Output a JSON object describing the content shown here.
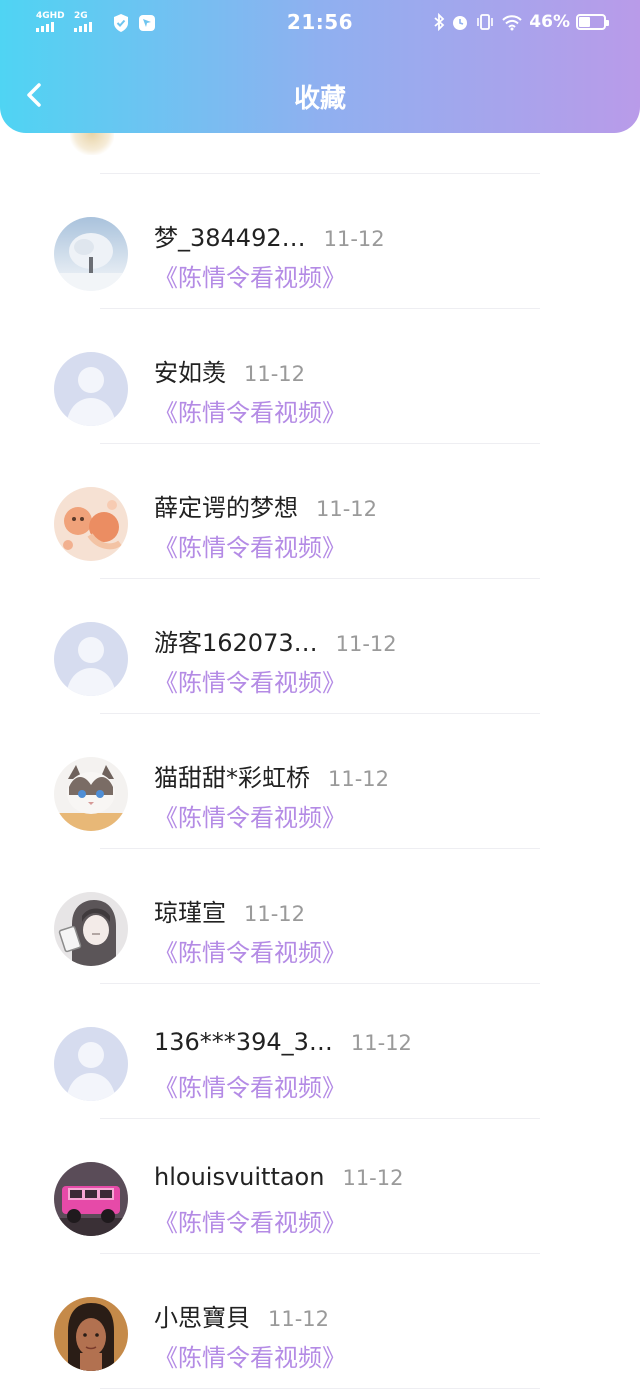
{
  "status_bar": {
    "net1": "4GHD",
    "net2": "2G",
    "time": "21:56",
    "battery": "46%",
    "battery_level": 0.46
  },
  "nav": {
    "title": "收藏"
  },
  "items": [
    {
      "name": "梦_384492…",
      "date": "11-12",
      "title": "《陈情令看视频》",
      "avatar": "snow-tree"
    },
    {
      "name": "安如羡",
      "date": "11-12",
      "title": "《陈情令看视频》",
      "avatar": "default"
    },
    {
      "name": "薛定谔的梦想",
      "date": "11-12",
      "title": "《陈情令看视频》",
      "avatar": "fox"
    },
    {
      "name": "游客162073…",
      "date": "11-12",
      "title": "《陈情令看视频》",
      "avatar": "default"
    },
    {
      "name": "猫甜甜*彩虹桥",
      "date": "11-12",
      "title": "《陈情令看视频》",
      "avatar": "cat"
    },
    {
      "name": "琼瑾宣",
      "date": "11-12",
      "title": "《陈情令看视频》",
      "avatar": "anime-girl"
    },
    {
      "name": "136***394_3…",
      "date": "11-12",
      "title": "《陈情令看视频》",
      "avatar": "default"
    },
    {
      "name": "hlouisvuittaon",
      "date": "11-12",
      "title": "《陈情令看视频》",
      "avatar": "pink-car"
    },
    {
      "name": "小思寶貝",
      "date": "11-12",
      "title": "《陈情令看视频》",
      "avatar": "portrait"
    }
  ],
  "colors": {
    "header_gradient": [
      "#4fd4f3",
      "#8fb0f0",
      "#b99be9"
    ],
    "accent_purple": "#b48be5",
    "date_gray": "#9a9a9a"
  }
}
